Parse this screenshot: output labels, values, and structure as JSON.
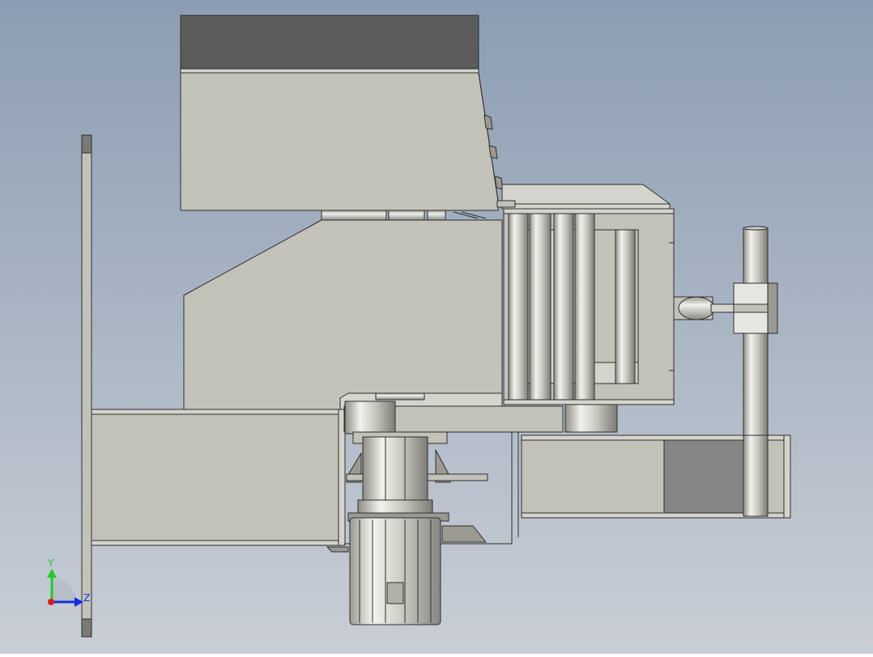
{
  "viewport": {
    "background_top": "#8c9db3",
    "background_bottom": "#c9ced6"
  },
  "colors": {
    "body": "#c2c2b9",
    "body_light": "#d4d4cc",
    "body_dark": "#9a9a92",
    "top_block": "#5c5c5c",
    "edge": "#2e2e2e",
    "gray_panel": "#858585"
  },
  "triad": {
    "y_label": "Y",
    "z_label": "Z",
    "y_color": "#1fcc2a",
    "z_color": "#1430e0",
    "origin_color": "#e01a1a"
  }
}
